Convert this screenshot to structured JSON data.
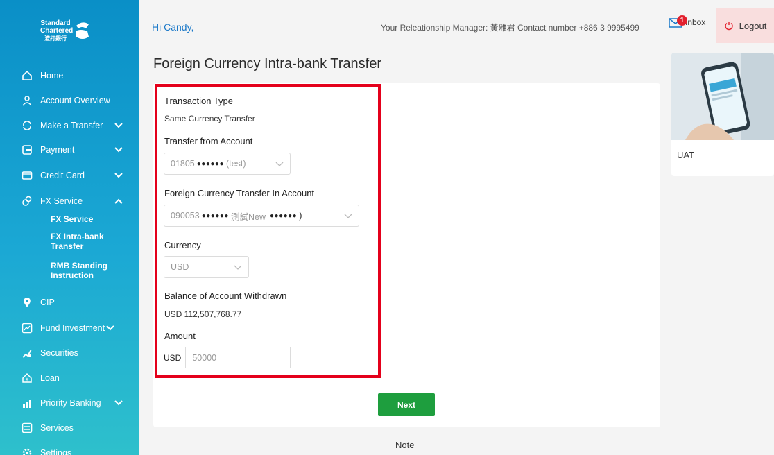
{
  "brand": {
    "line1": "Standard",
    "line2": "Chartered",
    "line3": "渣打銀行"
  },
  "sidebar": {
    "items": [
      {
        "label": "Home",
        "icon": "home-icon",
        "expand": ""
      },
      {
        "label": "Account Overview",
        "icon": "user-icon",
        "expand": ""
      },
      {
        "label": "Make a Transfer",
        "icon": "transfer-icon",
        "expand": "down"
      },
      {
        "label": "Payment",
        "icon": "payment-icon",
        "expand": "down"
      },
      {
        "label": "Credit Card",
        "icon": "credit-card-icon",
        "expand": "down"
      },
      {
        "label": "FX Service",
        "icon": "fx-icon",
        "expand": "up"
      },
      {
        "label": "CIP",
        "icon": "cip-icon",
        "expand": ""
      },
      {
        "label": "Fund Investment",
        "icon": "fund-icon",
        "expand": "down"
      },
      {
        "label": "Securities",
        "icon": "securities-icon",
        "expand": ""
      },
      {
        "label": "Loan",
        "icon": "loan-icon",
        "expand": ""
      },
      {
        "label": "Priority Banking",
        "icon": "priority-icon",
        "expand": "down"
      },
      {
        "label": "Services",
        "icon": "services-icon",
        "expand": ""
      },
      {
        "label": "Settings",
        "icon": "settings-icon",
        "expand": ""
      }
    ],
    "fx_sub": [
      "FX Service",
      "FX Intra-bank Transfer",
      "RMB Standing Instruction"
    ]
  },
  "header": {
    "greeting": "Hi Candy,",
    "rm_text": "Your Releationship Manager: 黃雅君 Contact number +886 3 9995499",
    "inbox_label": "Inbox",
    "inbox_count": "1",
    "logout_label": "Logout"
  },
  "main": {
    "title": "Foreign Currency Intra-bank Transfer",
    "transaction_type_label": "Transaction Type",
    "transaction_type_value": "Same Currency Transfer",
    "from_account_label": "Transfer from Account",
    "from_account_prefix": "01805",
    "from_account_masked": "●●●●●●",
    "from_account_suffix": "(test)",
    "in_account_label": "Foreign Currency Transfer In Account",
    "in_account_prefix": "090053",
    "in_account_masked": "●●●●●●",
    "in_account_name": "測試New",
    "in_account_masked2": "●●●●●●",
    "in_account_suffix": ")",
    "currency_label": "Currency",
    "currency_value": "USD",
    "balance_label": "Balance of Account Withdrawn",
    "balance_value": "USD 112,507,768.77",
    "amount_label": "Amount",
    "amount_currency": "USD",
    "amount_value": "50000",
    "next_label": "Next",
    "note_label": "Note"
  },
  "promo": {
    "label": "UAT"
  },
  "colors": {
    "sidebar_top": "#0a8fc7",
    "sidebar_bottom": "#2ec0cc",
    "accent_green": "#1e9e3e",
    "highlight_red": "#e4001b",
    "greeting_blue": "#1a78c8"
  }
}
